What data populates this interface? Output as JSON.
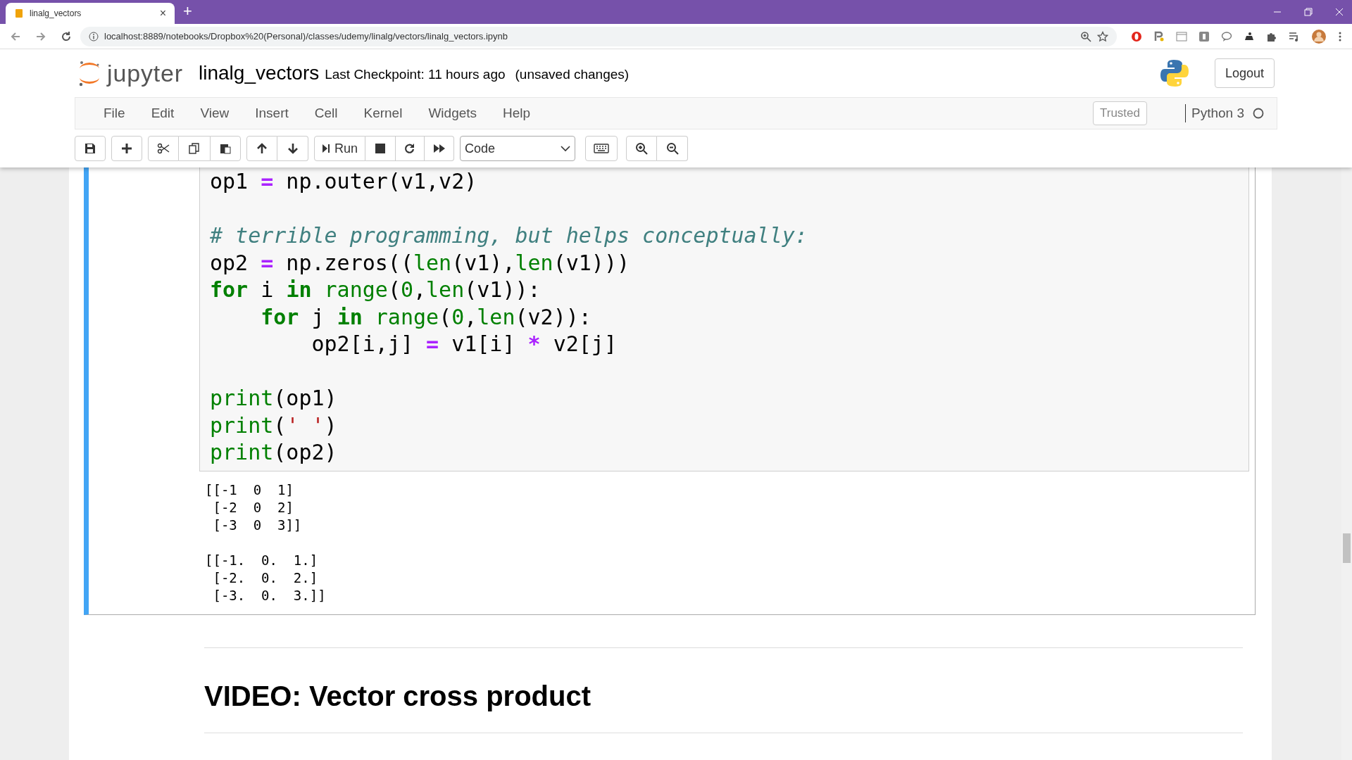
{
  "browser": {
    "tab_title": "linalg_vectors",
    "tab_close": "×",
    "new_tab": "+",
    "address": "localhost:8889/notebooks/Dropbox%20(Personal)/classes/udemy/linalg/vectors/linalg_vectors.ipynb"
  },
  "header": {
    "logo_text": "jupyter",
    "notebook_name": "linalg_vectors",
    "checkpoint": "Last Checkpoint: 11 hours ago",
    "autosave_status": "(unsaved changes)",
    "logout": "Logout"
  },
  "menu": [
    "File",
    "Edit",
    "View",
    "Insert",
    "Cell",
    "Kernel",
    "Widgets",
    "Help"
  ],
  "trusted": "Trusted",
  "kernel": "Python 3",
  "toolbar": {
    "run": "Run",
    "cell_type": "Code"
  },
  "cell": {
    "code_blocks": [
      [
        {
          "tokens": [
            {
              "kind": "plain",
              "text": "op1 "
            },
            {
              "kind": "operator",
              "text": "="
            },
            {
              "kind": "plain",
              "text": " np.outer(v1,v2)"
            }
          ]
        }
      ],
      [
        {
          "tokens": [
            {
              "kind": "comment",
              "text": "# terrible programming, but helps conceptually:"
            }
          ]
        },
        {
          "tokens": [
            {
              "kind": "plain",
              "text": "op2 "
            },
            {
              "kind": "operator",
              "text": "="
            },
            {
              "kind": "plain",
              "text": " np.zeros(("
            },
            {
              "kind": "builtin",
              "text": "len"
            },
            {
              "kind": "plain",
              "text": "(v1),"
            },
            {
              "kind": "builtin",
              "text": "len"
            },
            {
              "kind": "plain",
              "text": "(v1)))"
            }
          ]
        },
        {
          "tokens": [
            {
              "kind": "keyword",
              "text": "for"
            },
            {
              "kind": "plain",
              "text": " i "
            },
            {
              "kind": "keyword",
              "text": "in"
            },
            {
              "kind": "builtin",
              "text": " range"
            },
            {
              "kind": "plain",
              "text": "("
            },
            {
              "kind": "number",
              "text": "0"
            },
            {
              "kind": "plain",
              "text": ","
            },
            {
              "kind": "builtin",
              "text": "len"
            },
            {
              "kind": "plain",
              "text": "(v1)):"
            }
          ]
        },
        {
          "tokens": [
            {
              "kind": "keyword",
              "text": "    for"
            },
            {
              "kind": "plain",
              "text": " j "
            },
            {
              "kind": "keyword",
              "text": "in"
            },
            {
              "kind": "builtin",
              "text": " range"
            },
            {
              "kind": "plain",
              "text": "("
            },
            {
              "kind": "number",
              "text": "0"
            },
            {
              "kind": "plain",
              "text": ","
            },
            {
              "kind": "builtin",
              "text": "len"
            },
            {
              "kind": "plain",
              "text": "(v2)):"
            }
          ]
        },
        {
          "tokens": [
            {
              "kind": "plain",
              "text": "        op2[i,j] "
            },
            {
              "kind": "operator",
              "text": "="
            },
            {
              "kind": "plain",
              "text": " v1[i] "
            },
            {
              "kind": "operator",
              "text": "*"
            },
            {
              "kind": "plain",
              "text": " v2[j]"
            }
          ]
        }
      ],
      [
        {
          "tokens": [
            {
              "kind": "builtin",
              "text": "print"
            },
            {
              "kind": "plain",
              "text": "(op1)"
            }
          ]
        },
        {
          "tokens": [
            {
              "kind": "builtin",
              "text": "print"
            },
            {
              "kind": "plain",
              "text": "("
            },
            {
              "kind": "string",
              "text": "' '"
            },
            {
              "kind": "plain",
              "text": ")"
            }
          ]
        },
        {
          "tokens": [
            {
              "kind": "builtin",
              "text": "print"
            },
            {
              "kind": "plain",
              "text": "(op2)"
            }
          ]
        }
      ]
    ],
    "output": [
      [
        "[[-1  0  1]",
        " [-2  0  2]",
        " [-3  0  3]]"
      ],
      [
        "[[-1.  0.  1.]",
        " [-2.  0.  2.]",
        " [-3.  0.  3.]]"
      ]
    ]
  },
  "heading": "VIDEO: Vector cross product"
}
